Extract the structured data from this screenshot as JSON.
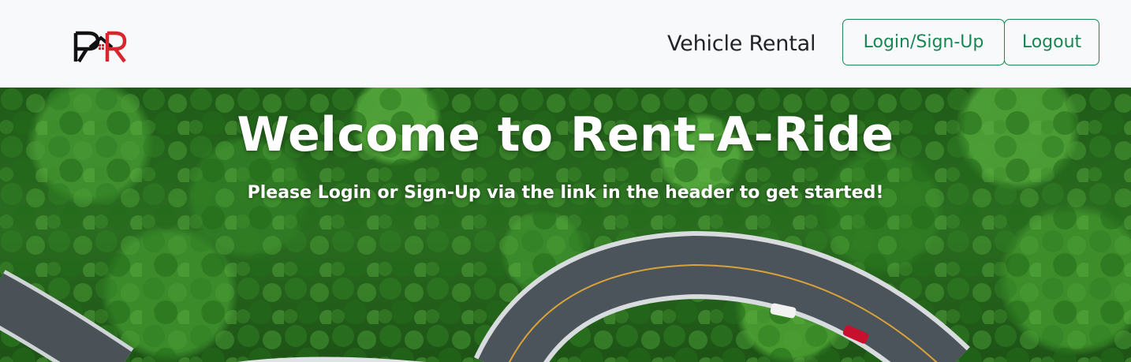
{
  "navbar": {
    "brand_text": "Vehicle Rental",
    "login_label": "Login/Sign-Up",
    "logout_label": "Logout",
    "accent_color": "#198754",
    "logo_icon": "rent-a-ride-logo-icon"
  },
  "hero": {
    "title": "Welcome to Rent-A-Ride",
    "subtitle": "Please Login or Sign-Up via the link in the header to get started!",
    "background": "aerial-forest-road-image"
  }
}
